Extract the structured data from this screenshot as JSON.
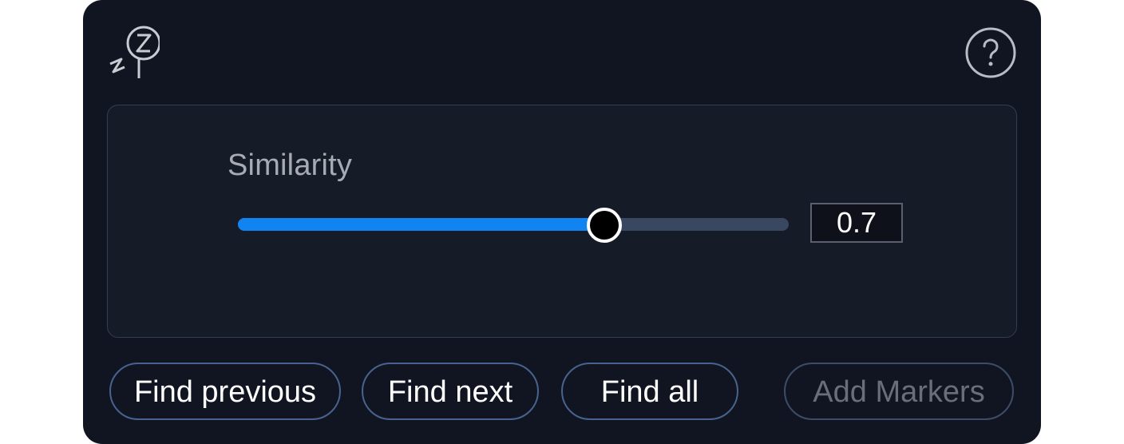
{
  "header": {
    "logo_icon": "zz-sleep-logo-icon",
    "help_icon": "question-mark-circle-icon"
  },
  "similarity": {
    "label": "Similarity",
    "value": "0.7",
    "fill_fraction": 0.66
  },
  "buttons": {
    "find_previous": "Find previous",
    "find_next": "Find next",
    "find_all": "Find all",
    "add_markers": "Add Markers"
  },
  "colors": {
    "panel_bg": "#111521",
    "accent": "#1084f0",
    "track": "#3a4761",
    "button_border": "#47638e"
  }
}
